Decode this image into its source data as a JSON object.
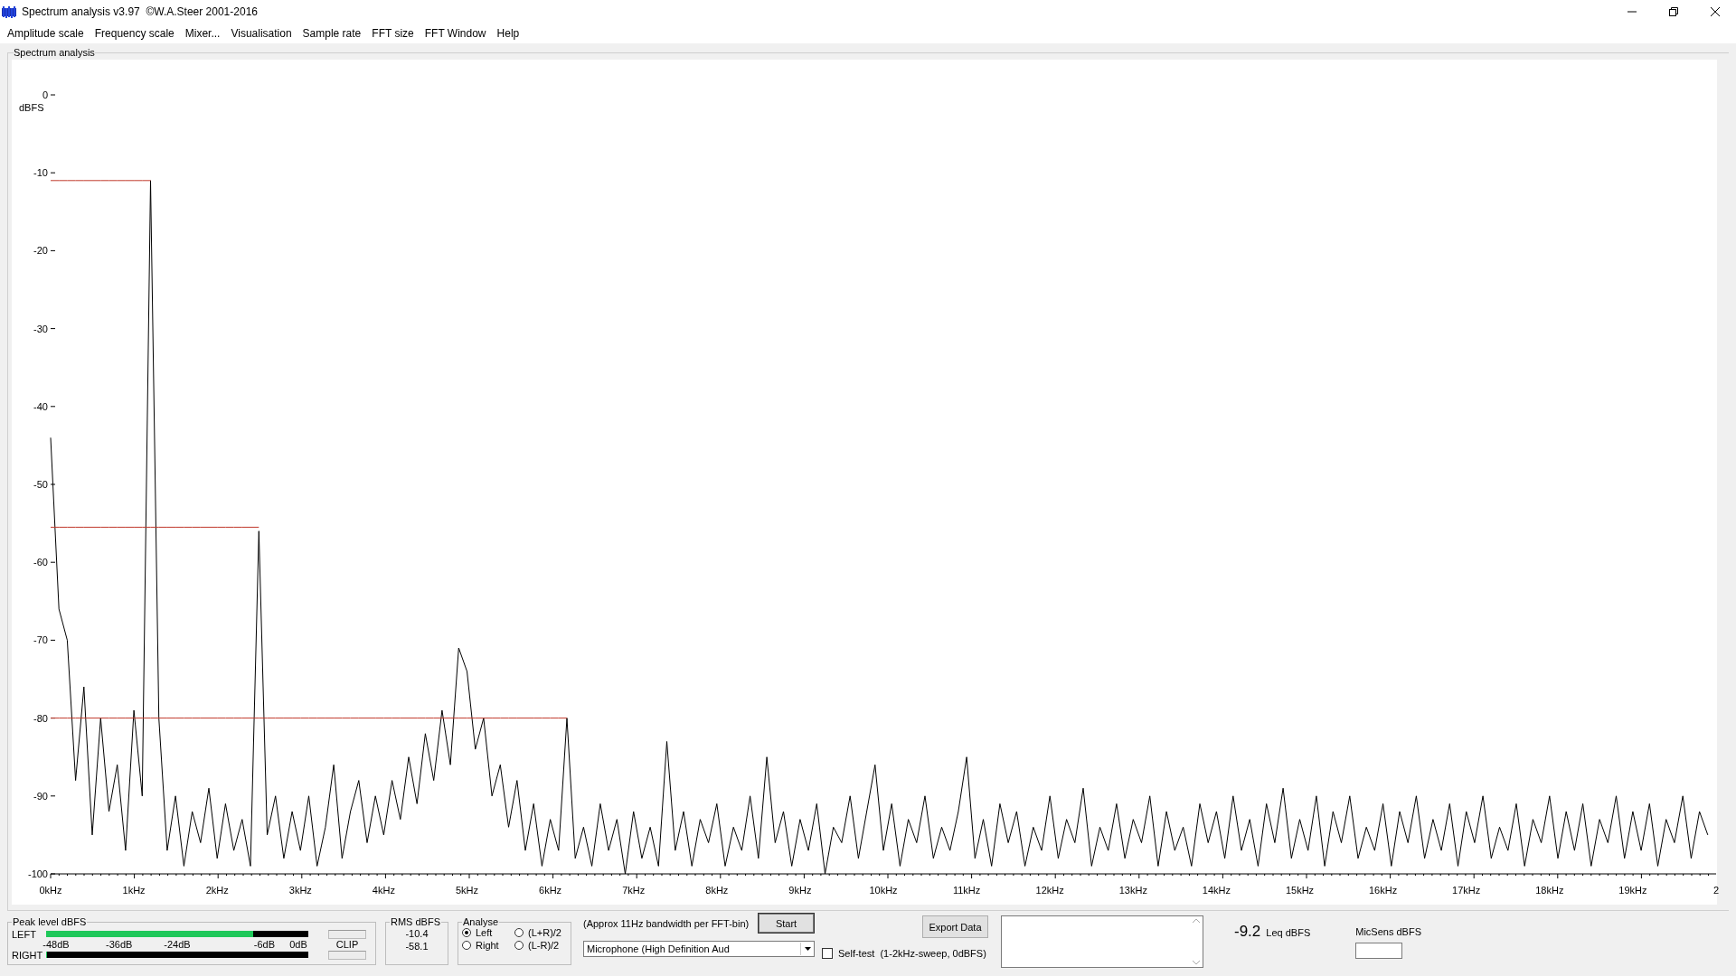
{
  "window": {
    "title": "Spectrum analysis v3.97  ©W.A.Steer 2001-2016"
  },
  "menu": [
    "Amplitude scale",
    "Frequency scale",
    "Mixer...",
    "Visualisation",
    "Sample rate",
    "FFT size",
    "FFT Window",
    "Help"
  ],
  "plot": {
    "group_label": "Spectrum analysis",
    "cut_axis_label": "2",
    "chart_data": {
      "type": "line",
      "ylabel": "dBFS",
      "xlim": [
        0,
        20
      ],
      "ylim": [
        -100,
        0
      ],
      "yticks": [
        {
          "value": 0,
          "label": "0"
        },
        {
          "value": -10,
          "label": "-10"
        },
        {
          "value": -20,
          "label": "-20"
        },
        {
          "value": -30,
          "label": "-30"
        },
        {
          "value": -40,
          "label": "-40"
        },
        {
          "value": -50,
          "label": "-50"
        },
        {
          "value": -60,
          "label": "-60"
        },
        {
          "value": -70,
          "label": "-70"
        },
        {
          "value": -80,
          "label": "-80"
        },
        {
          "value": -90,
          "label": "-90"
        },
        {
          "value": -100,
          "label": "-100"
        }
      ],
      "xticks": [
        {
          "value": 0,
          "label": "0kHz"
        },
        {
          "value": 1,
          "label": "1kHz"
        },
        {
          "value": 2,
          "label": "2kHz"
        },
        {
          "value": 3,
          "label": "3kHz"
        },
        {
          "value": 4,
          "label": "4kHz"
        },
        {
          "value": 5,
          "label": "5kHz"
        },
        {
          "value": 6,
          "label": "6kHz"
        },
        {
          "value": 7,
          "label": "7kHz"
        },
        {
          "value": 8,
          "label": "8kHz"
        },
        {
          "value": 9,
          "label": "9kHz"
        },
        {
          "value": 10,
          "label": "10kHz"
        },
        {
          "value": 11,
          "label": "11kHz"
        },
        {
          "value": 12,
          "label": "12kHz"
        },
        {
          "value": 13,
          "label": "13kHz"
        },
        {
          "value": 14,
          "label": "14kHz"
        },
        {
          "value": 15,
          "label": "15kHz"
        },
        {
          "value": 16,
          "label": "16kHz"
        },
        {
          "value": 17,
          "label": "17kHz"
        },
        {
          "value": 18,
          "label": "18kHz"
        },
        {
          "value": 19,
          "label": "19kHz"
        }
      ],
      "x": [
        0,
        0.1,
        0.2,
        0.3,
        0.4,
        0.5,
        0.6,
        0.7,
        0.8,
        0.9,
        1,
        1.1,
        1.2,
        1.3,
        1.4,
        1.5,
        1.6,
        1.7,
        1.8,
        1.9,
        2,
        2.1,
        2.2,
        2.3,
        2.4,
        2.5,
        2.6,
        2.7,
        2.8,
        2.9,
        3,
        3.1,
        3.2,
        3.3,
        3.4,
        3.5,
        3.6,
        3.7,
        3.8,
        3.9,
        4,
        4.1,
        4.2,
        4.3,
        4.4,
        4.5,
        4.6,
        4.7,
        4.8,
        4.9,
        5,
        5.1,
        5.2,
        5.3,
        5.4,
        5.5,
        5.6,
        5.7,
        5.8,
        5.9,
        6,
        6.1,
        6.2,
        6.3,
        6.4,
        6.5,
        6.6,
        6.7,
        6.8,
        6.9,
        7,
        7.1,
        7.2,
        7.3,
        7.4,
        7.5,
        7.6,
        7.7,
        7.8,
        7.9,
        8,
        8.1,
        8.2,
        8.3,
        8.4,
        8.5,
        8.6,
        8.7,
        8.8,
        8.9,
        9,
        9.1,
        9.2,
        9.3,
        9.4,
        9.5,
        9.6,
        9.7,
        9.8,
        9.9,
        10,
        10.1,
        10.2,
        10.3,
        10.4,
        10.5,
        10.6,
        10.7,
        10.8,
        10.9,
        11,
        11.1,
        11.2,
        11.3,
        11.4,
        11.5,
        11.6,
        11.7,
        11.8,
        11.9,
        12,
        12.1,
        12.2,
        12.3,
        12.4,
        12.5,
        12.6,
        12.7,
        12.8,
        12.9,
        13,
        13.1,
        13.2,
        13.3,
        13.4,
        13.5,
        13.6,
        13.7,
        13.8,
        13.9,
        14,
        14.1,
        14.2,
        14.3,
        14.4,
        14.5,
        14.6,
        14.7,
        14.8,
        14.9,
        15,
        15.1,
        15.2,
        15.3,
        15.4,
        15.5,
        15.6,
        15.7,
        15.8,
        15.9,
        16,
        16.1,
        16.2,
        16.3,
        16.4,
        16.5,
        16.6,
        16.7,
        16.8,
        16.9,
        17,
        17.1,
        17.2,
        17.3,
        17.4,
        17.5,
        17.6,
        17.7,
        17.8,
        17.9,
        18,
        18.1,
        18.2,
        18.3,
        18.4,
        18.5,
        18.6,
        18.7,
        18.8,
        18.9,
        19,
        19.1,
        19.2,
        19.3,
        19.4,
        19.5,
        19.6,
        19.7,
        19.8,
        19.9
      ],
      "series": [
        {
          "color": "#000000",
          "values": [
            -44,
            -66,
            -70,
            -88,
            -76,
            -95,
            -80,
            -92,
            -86,
            -97,
            -79,
            -90,
            -11,
            -80,
            -97,
            -90,
            -99,
            -92,
            -96,
            -89,
            -98,
            -91,
            -97,
            -93,
            -99,
            -56,
            -95,
            -90,
            -98,
            -92,
            -97,
            -90,
            -99,
            -94,
            -86,
            -98,
            -92,
            -88,
            -96,
            -90,
            -95,
            -88,
            -93,
            -85,
            -91,
            -82,
            -88,
            -79,
            -86,
            -71,
            -74,
            -84,
            -80,
            -90,
            -86,
            -94,
            -88,
            -97,
            -91,
            -99,
            -93,
            -97,
            -80,
            -98,
            -94,
            -99,
            -91,
            -97,
            -93,
            -100,
            -92,
            -98,
            -94,
            -99,
            -83,
            -97,
            -92,
            -99,
            -93,
            -96,
            -91,
            -99,
            -94,
            -97,
            -90,
            -98,
            -85,
            -96,
            -92,
            -99,
            -93,
            -97,
            -91,
            -100,
            -94,
            -96,
            -90,
            -98,
            -92,
            -86,
            -97,
            -91,
            -99,
            -93,
            -96,
            -90,
            -98,
            -94,
            -97,
            -92,
            -85,
            -98,
            -93,
            -99,
            -91,
            -96,
            -92,
            -99,
            -94,
            -97,
            -90,
            -98,
            -93,
            -96,
            -89,
            -99,
            -94,
            -97,
            -91,
            -98,
            -93,
            -96,
            -90,
            -99,
            -92,
            -97,
            -94,
            -99,
            -91,
            -96,
            -92,
            -98,
            -90,
            -97,
            -93,
            -99,
            -91,
            -96,
            -89,
            -98,
            -93,
            -97,
            -90,
            -99,
            -92,
            -96,
            -90,
            -98,
            -94,
            -97,
            -91,
            -99,
            -92,
            -96,
            -90,
            -98,
            -93,
            -97,
            -91,
            -99,
            -92,
            -96,
            -90,
            -98,
            -94,
            -97,
            -91,
            -99,
            -93,
            -96,
            -90,
            -98,
            -92,
            -97,
            -91,
            -99,
            -93,
            -96,
            -90,
            -98,
            -92,
            -97,
            -91,
            -99,
            -93,
            -96,
            -90,
            -98,
            -92,
            -95
          ]
        },
        {
          "color": "#c0392b",
          "values": [
            -11,
            -11,
            -11,
            -11,
            -11,
            -11,
            -11,
            -11,
            -11,
            -11,
            -11,
            -11,
            -11,
            null,
            null,
            null,
            null,
            null,
            null,
            null,
            null,
            null,
            null,
            null,
            null,
            null,
            null,
            null,
            null,
            null,
            null,
            null,
            null,
            null,
            null,
            null,
            null,
            null,
            null,
            null,
            null,
            null,
            null,
            null,
            null,
            null,
            null,
            null,
            null,
            null,
            null,
            null,
            null,
            null,
            null,
            null,
            null,
            null,
            null,
            null,
            null,
            null,
            null,
            null,
            null,
            null,
            null,
            null,
            null,
            null,
            null,
            null,
            null,
            null,
            null,
            null,
            null,
            null,
            null,
            null,
            null,
            null,
            null,
            null,
            null,
            null,
            null,
            null,
            null,
            null,
            null,
            null,
            null,
            null,
            null,
            null,
            null,
            null,
            null,
            null,
            null,
            null,
            null,
            null,
            null,
            null,
            null,
            null,
            null,
            null,
            null,
            null,
            null,
            null,
            null,
            null,
            null,
            null,
            null,
            null,
            null,
            null,
            null,
            null,
            null,
            null,
            null,
            null,
            null,
            null,
            null,
            null,
            null,
            null,
            null,
            null,
            null,
            null,
            null,
            null,
            null,
            null,
            null,
            null,
            null,
            null,
            null,
            null,
            null,
            null,
            null,
            null,
            null,
            null,
            null,
            null,
            null,
            null,
            null,
            null,
            null,
            null,
            null,
            null,
            null,
            null,
            null,
            null,
            null,
            null,
            null,
            null,
            null,
            null,
            null,
            null,
            null,
            null,
            null,
            null,
            null,
            null,
            null,
            null,
            null,
            null,
            null,
            null,
            null,
            null,
            null,
            null,
            null,
            null,
            null,
            null,
            null,
            null,
            null,
            null
          ]
        },
        {
          "color": "#c0392b",
          "values": [
            -55.5,
            -55.5,
            -55.5,
            -55.5,
            -55.5,
            -55.5,
            -55.5,
            -55.5,
            -55.5,
            -55.5,
            -55.5,
            -55.5,
            -55.5,
            -55.5,
            -55.5,
            -55.5,
            -55.5,
            -55.5,
            -55.5,
            -55.5,
            -55.5,
            -55.5,
            -55.5,
            -55.5,
            -55.5,
            -55.5,
            null,
            null,
            null,
            null,
            null,
            null,
            null,
            null,
            null,
            null,
            null,
            null,
            null,
            null,
            null,
            null,
            null,
            null,
            null,
            null,
            null,
            null,
            null,
            null,
            null,
            null,
            null,
            null,
            null,
            null,
            null,
            null,
            null,
            null,
            null,
            null,
            null,
            null,
            null,
            null,
            null,
            null,
            null,
            null,
            null,
            null,
            null,
            null,
            null,
            null,
            null,
            null,
            null,
            null,
            null,
            null,
            null,
            null,
            null,
            null,
            null,
            null,
            null,
            null,
            null,
            null,
            null,
            null,
            null,
            null,
            null,
            null,
            null,
            null,
            null,
            null,
            null,
            null,
            null,
            null,
            null,
            null,
            null,
            null,
            null,
            null,
            null,
            null,
            null,
            null,
            null,
            null,
            null,
            null,
            null,
            null,
            null,
            null,
            null,
            null,
            null,
            null,
            null,
            null,
            null,
            null,
            null,
            null,
            null,
            null,
            null,
            null,
            null,
            null,
            null,
            null,
            null,
            null,
            null,
            null,
            null,
            null,
            null,
            null,
            null,
            null,
            null,
            null,
            null,
            null,
            null,
            null,
            null,
            null,
            null,
            null,
            null,
            null,
            null,
            null,
            null,
            null,
            null,
            null,
            null,
            null,
            null,
            null,
            null,
            null,
            null,
            null,
            null,
            null,
            null,
            null,
            null,
            null,
            null,
            null,
            null,
            null,
            null,
            null,
            null,
            null,
            null,
            null,
            null,
            null,
            null,
            null,
            null,
            null
          ]
        },
        {
          "color": "#c0392b",
          "values": [
            -80,
            -80,
            -80,
            -80,
            -80,
            -80,
            -80,
            -80,
            -80,
            -80,
            -80,
            -80,
            -80,
            -80,
            -80,
            -80,
            -80,
            -80,
            -80,
            -80,
            -80,
            -80,
            -80,
            -80,
            -80,
            -80,
            -80,
            -80,
            -80,
            -80,
            -80,
            -80,
            -80,
            -80,
            -80,
            -80,
            -80,
            -80,
            -80,
            -80,
            -80,
            -80,
            -80,
            -80,
            -80,
            -80,
            -80,
            -80,
            -80,
            -80,
            -80,
            -80,
            -80,
            -80,
            -80,
            -80,
            -80,
            -80,
            -80,
            -80,
            -80,
            -80,
            -80,
            null,
            null,
            null,
            null,
            null,
            null,
            null,
            null,
            null,
            null,
            null,
            null,
            null,
            null,
            null,
            null,
            null,
            null,
            null,
            null,
            null,
            null,
            null,
            null,
            null,
            null,
            null,
            null,
            null,
            null,
            null,
            null,
            null,
            null,
            null,
            null,
            null,
            null,
            null,
            null,
            null,
            null,
            null,
            null,
            null,
            null,
            null,
            null,
            null,
            null,
            null,
            null,
            null,
            null,
            null,
            null,
            null,
            null,
            null,
            null,
            null,
            null,
            null,
            null,
            null,
            null,
            null,
            null,
            null,
            null,
            null,
            null,
            null,
            null,
            null,
            null,
            null,
            null,
            null,
            null,
            null,
            null,
            null,
            null,
            null,
            null,
            null,
            null,
            null,
            null,
            null,
            null,
            null,
            null,
            null,
            null,
            null,
            null,
            null,
            null,
            null,
            null,
            null,
            null,
            null,
            null,
            null,
            null,
            null,
            null,
            null,
            null,
            null,
            null,
            null,
            null,
            null,
            null,
            null,
            null,
            null,
            null,
            null,
            null,
            null,
            null,
            null,
            null,
            null,
            null,
            null,
            null,
            null,
            null,
            null,
            null,
            null
          ]
        }
      ]
    }
  },
  "peak_level": {
    "label": "Peak level dBFS",
    "clip": "CLIP",
    "scale": [
      "-48dB",
      "-36dB",
      "-24dB",
      "-6dB",
      "0dB"
    ],
    "channels": [
      {
        "name": "LEFT",
        "level": 0.79
      },
      {
        "name": "RIGHT",
        "level": 0
      }
    ]
  },
  "rms": {
    "label": "RMS dBFS",
    "values": [
      "-10.4",
      "-58.1"
    ]
  },
  "analyse": {
    "label": "Analyse",
    "options": [
      {
        "label": "Left",
        "selected": true
      },
      {
        "label": "(L+R)/2",
        "selected": false
      },
      {
        "label": "Right",
        "selected": false
      },
      {
        "label": "(L-R)/2",
        "selected": false
      }
    ]
  },
  "bandwidth_note": "(Approx 11Hz bandwidth per FFT-bin)",
  "start_button": "Start",
  "device_select": {
    "value": "Microphone (High Definition Aud"
  },
  "self_test": {
    "label": "Self-test  (1-2kHz-sweep, 0dBFS)",
    "checked": false
  },
  "export_button": "Export Data",
  "leq": {
    "value": "-9.2",
    "unit": "Leq dBFS"
  },
  "mic_sens": {
    "label": "MicSens dBFS"
  }
}
